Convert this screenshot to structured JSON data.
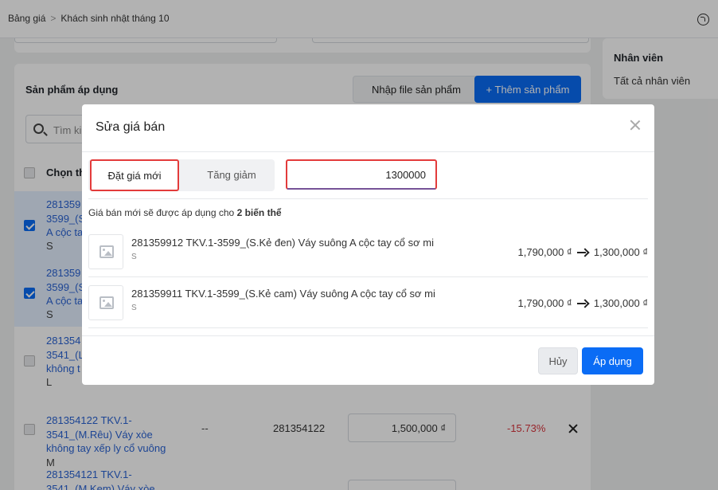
{
  "breadcrumb": {
    "parent": "Bảng giá",
    "separator": ">",
    "current": "Khách sinh nhật tháng 10"
  },
  "sidebar_card": {
    "title": "Nhân viên",
    "value": "Tất cả nhân viên"
  },
  "products_card": {
    "title": "Sản phẩm áp dụng",
    "import_button": "Nhập file sản phẩm",
    "add_button": "+ Thêm sản phẩm",
    "search_placeholder": "Tìm ki",
    "select_header": "Chọn th",
    "rows": [
      {
        "name": "281359\n3599_(S\nA cộc ta",
        "variant": "S",
        "selected": true
      },
      {
        "name": "281359\n3599_(S\nA cộc ta",
        "variant": "S",
        "selected": true
      },
      {
        "name": "281354\n3541_(L\nkhông t",
        "variant": "L",
        "selected": false
      },
      {
        "name": "281354122 TKV.1-\n3541_(M.Rêu) Váy xòe\nkhông tay xếp ly cổ vuông",
        "variant": "M",
        "selected": false,
        "dash": "--",
        "code": "281354122",
        "price": "1,500,000 ₫",
        "percent": "-15.73%"
      },
      {
        "name": "281354121 TKV.1-\n3541_(M.Kem) Váy xòe",
        "variant": "",
        "selected": false
      }
    ]
  },
  "modal": {
    "title": "Sửa giá bán",
    "tabs": {
      "active": "Đặt giá mới",
      "inactive": "Tăng giảm"
    },
    "price_value": "1300000",
    "info_prefix": "Giá bán mới sẽ được áp dụng cho",
    "info_count": "2 biến thể",
    "items": [
      {
        "name": "281359912 TKV.1-3599_(S.Kẻ đen) Váy suông A cộc tay cổ sơ mi",
        "variant": "S",
        "old_price": "1,790,000 ₫",
        "new_price": "1,300,000 ₫"
      },
      {
        "name": "281359911 TKV.1-3599_(S.Kẻ cam) Váy suông A cộc tay cổ sơ mi",
        "variant": "S",
        "old_price": "1,790,000 ₫",
        "new_price": "1,300,000 ₫"
      }
    ],
    "cancel_button": "Hủy",
    "apply_button": "Áp dụng"
  },
  "colors": {
    "primary": "#0a6cf5",
    "highlight": "#e33b3b",
    "link": "#2a63d4",
    "negative": "#d9363e"
  }
}
